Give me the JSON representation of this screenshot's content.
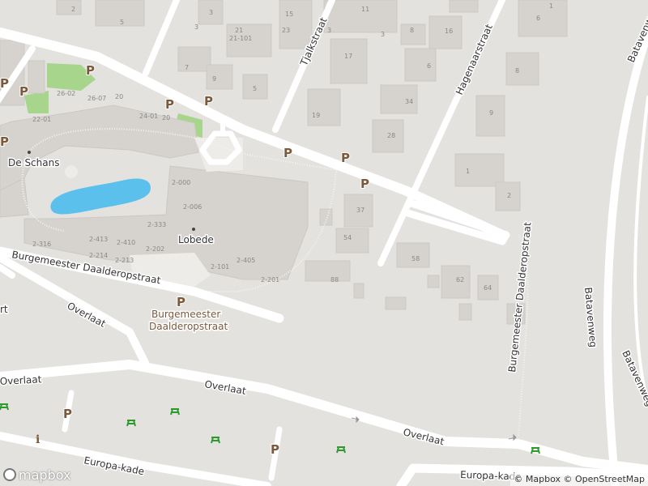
{
  "map": {
    "streets": {
      "tjalkstraat": "Tjalkstraat",
      "hagenaarstraat": "Hagenaarstraat",
      "bd_left": "Burgemeester Daalderopstraat",
      "bd_right": "Burgemeester Daalderopstraat",
      "overlaat_1": "Overlaat",
      "overlaat_2": "Overlaat",
      "overlaat_3": "Overlaat",
      "overlaat_4": "Overlaat",
      "europa_1": "Europa-kade",
      "europa_2": "Europa-kade",
      "batavenweg_1": "Batavenweg",
      "batavenweg_2": "Batavenweg",
      "batavenweg_3": "Batavenweg"
    },
    "pois": {
      "de_schans": "De Schans",
      "lobede": "Lobede",
      "bd_parking_line1": "Burgemeester",
      "bd_parking_line2": "Daalderopstraat",
      "partial_left": "rt"
    },
    "parking_symbol": "P",
    "info_symbol": "i",
    "house_numbers": [
      "5",
      "2",
      "21",
      "21-101",
      "23",
      "11",
      "17",
      "16",
      "3",
      "6",
      "8",
      "9",
      "1",
      "2",
      "6",
      "34",
      "28",
      "7",
      "19",
      "9",
      "15",
      "5",
      "3",
      "3",
      "8",
      "3",
      "1",
      "26-02",
      "26-07",
      "20",
      "24-01",
      "22-01",
      "20",
      "2-000",
      "2-006",
      "2-333",
      "2-316",
      "2-413",
      "2-410",
      "2-202",
      "2-214",
      "2-213",
      "2-101",
      "2-405",
      "2-201",
      "37",
      "54",
      "58",
      "62",
      "64",
      "88"
    ],
    "colors": {
      "land": "#e4e2df",
      "building": "#d6d3cf",
      "road": "#ffffff",
      "water": "#5bc0eb",
      "park": "#a6d58b",
      "parking": "#7a5a3c",
      "picnic": "#2e9a2e"
    },
    "icons": [
      "parking-icon",
      "picnic-icon",
      "info-icon",
      "poi-dot-icon"
    ]
  },
  "branding": {
    "logo_text": "mapbox",
    "attribution_mapbox": "© Mapbox",
    "attribution_osm": "© OpenStreetMap"
  }
}
